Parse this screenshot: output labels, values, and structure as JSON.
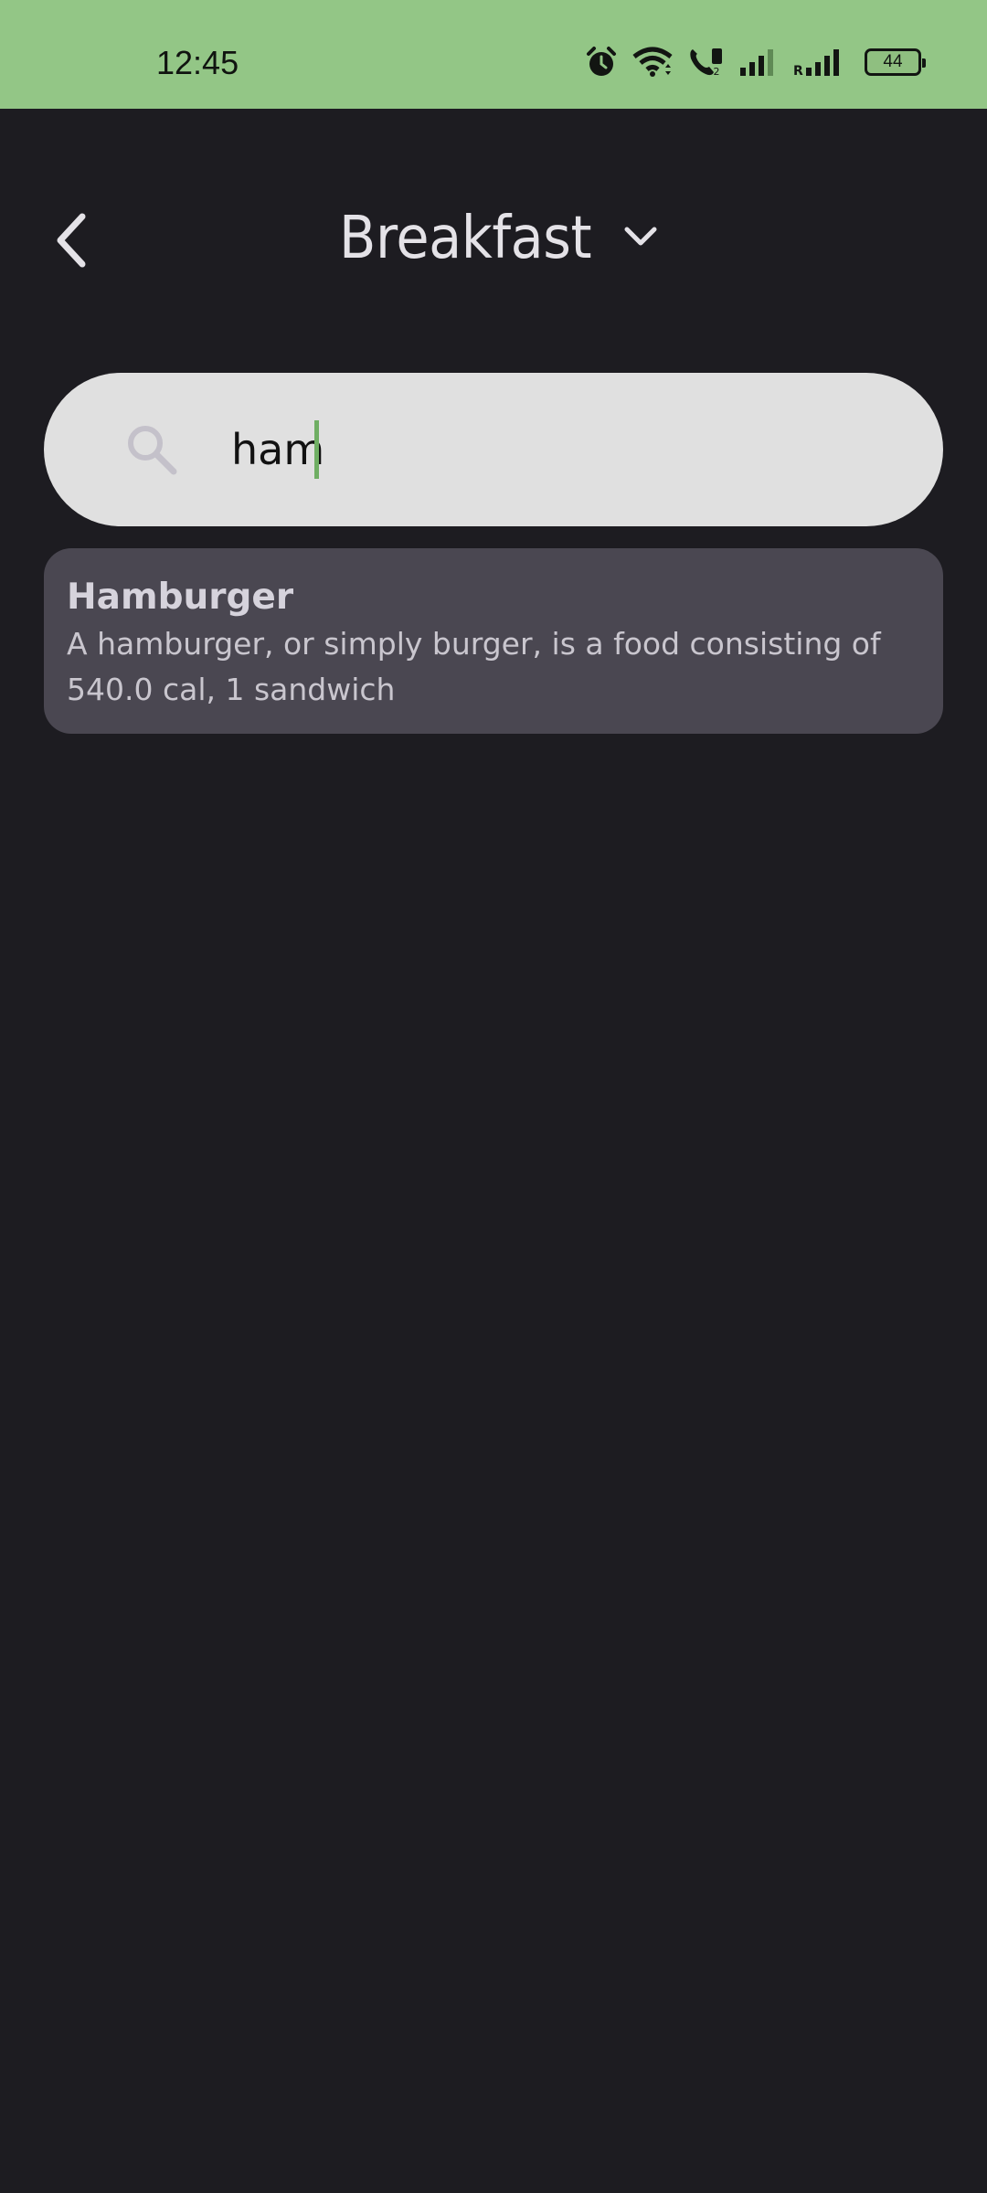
{
  "status_bar": {
    "time": "12:45",
    "battery": "44",
    "icons": [
      "alarm-icon",
      "wifi-icon",
      "wifi-calling-icon",
      "signal-sim1-icon",
      "signal-roaming-icon",
      "battery-icon"
    ],
    "background_color": "#93c686"
  },
  "header": {
    "back_icon": "chevron-left-icon",
    "title": "Breakfast",
    "dropdown_icon": "chevron-down-icon"
  },
  "search": {
    "icon": "search-icon",
    "value": "ham",
    "caret_color": "#6fae63"
  },
  "results": [
    {
      "title": "Hamburger",
      "description": "A hamburger, or simply burger, is a food consisting of",
      "meta": "540.0 cal, 1 sandwich"
    }
  ],
  "colors": {
    "background": "#1d1c21",
    "card": "#4a4751",
    "search_field": "#e0e0e0"
  }
}
